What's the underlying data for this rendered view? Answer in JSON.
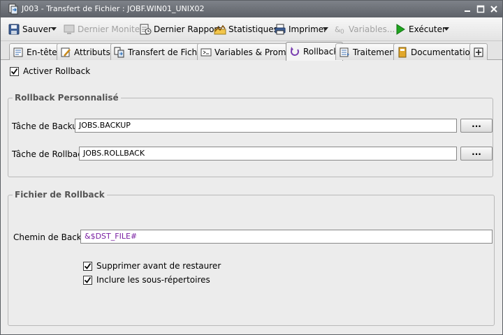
{
  "window": {
    "title": "J003 - Transfert de Fichier : JOBF.WIN01_UNIX02"
  },
  "toolbar": {
    "save_label": "Sauver",
    "last_monitor_label": "Dernier Moniteur",
    "last_report_label": "Dernier Rapport",
    "statistics_label": "Statistiques",
    "print_label": "Imprimer",
    "variables_label": "Variables...",
    "execute_label": "Exécuter"
  },
  "tabs": [
    {
      "label": "En-tête"
    },
    {
      "label": "Attributs"
    },
    {
      "label": "Transfert de Fichier"
    },
    {
      "label": "Variables & Prompts"
    },
    {
      "label": "Rollback",
      "active": true
    },
    {
      "label": "Traitement"
    },
    {
      "label": "Documentation"
    }
  ],
  "rollback": {
    "enable_label": "Activer Rollback",
    "enable_checked": true,
    "custom_group_title": "Rollback Personnalisé",
    "backup_task_label": "Tâche de Backup:",
    "backup_task_value": "JOBS.BACKUP",
    "rollback_task_label": "Tâche de Rollback:",
    "rollback_task_value": "JOBS.ROLLBACK",
    "browse_label": "...",
    "file_group_title": "Fichier de Rollback",
    "backup_path_label": "Chemin de Backup:",
    "backup_path_value": "&$DST_FILE#",
    "delete_before_restore_label": "Supprimer avant de restaurer",
    "delete_before_restore_checked": true,
    "include_subdirs_label": "Inclure les sous-répertoires",
    "include_subdirs_checked": true
  },
  "colors": {
    "titlebar": "#6b6f75",
    "variable_text": "#7a1fa2",
    "execute_icon": "#1fa51f"
  }
}
